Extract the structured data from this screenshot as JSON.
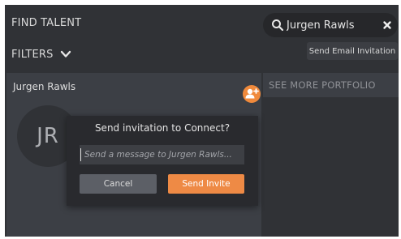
{
  "header": {
    "title": "FIND TALENT"
  },
  "search": {
    "value": "Jurgen Rawls",
    "search_icon": "search-icon",
    "clear_icon": "close-icon"
  },
  "filters": {
    "label": "FILTERS",
    "icon": "chevron-down-icon"
  },
  "send_email_invitation": {
    "label": "Send Email Invitation"
  },
  "talent_card": {
    "name": "Jurgen Rawls",
    "initials": "JR",
    "add_contact_icon": "add-contact-icon"
  },
  "portfolio": {
    "label": "SEE MORE PORTFOLIO"
  },
  "invite_dialog": {
    "title": "Send invitation to Connect?",
    "message_placeholder": "Send a message to Jurgen Rawls...",
    "message_value": "",
    "cancel_label": "Cancel",
    "send_label": "Send Invite"
  },
  "colors": {
    "accent": "#ee8a45",
    "background": "#303236",
    "card": "#3c3f45",
    "dialog": "#292a2e"
  }
}
